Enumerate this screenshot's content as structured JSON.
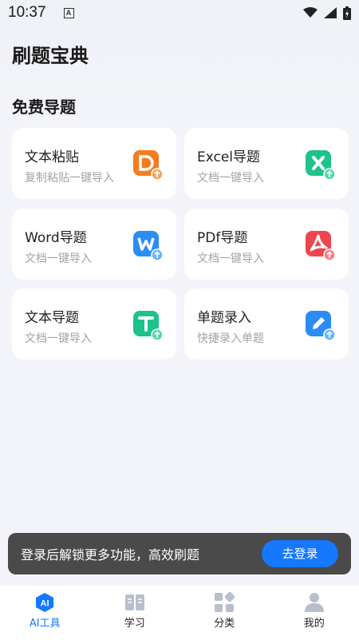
{
  "status_bar": {
    "time": "10:37",
    "notification_glyph": "A"
  },
  "header": {
    "title": "刷题宝典"
  },
  "section": {
    "title": "免费导题"
  },
  "cards": [
    {
      "title": "文本粘贴",
      "subtitle": "复制粘贴一键导入",
      "icon": "paste-doc-icon",
      "color": "#f57c1f"
    },
    {
      "title": "Excel导题",
      "subtitle": "文档一键导入",
      "icon": "excel-icon",
      "color": "#1ec28b"
    },
    {
      "title": "Word导题",
      "subtitle": "文档一键导入",
      "icon": "word-icon",
      "color": "#2b8cf5"
    },
    {
      "title": "PDf导题",
      "subtitle": "文档一键导入",
      "icon": "pdf-icon",
      "color": "#f0444f"
    },
    {
      "title": "文本导题",
      "subtitle": "文档一键导入",
      "icon": "text-doc-icon",
      "color": "#1ec28b"
    },
    {
      "title": "单题录入",
      "subtitle": "快捷录入单题",
      "icon": "pen-edit-icon",
      "color": "#2b8cf5"
    }
  ],
  "toast": {
    "message": "登录后解锁更多功能，高效刷题",
    "button": "去登录"
  },
  "tabbar": {
    "items": [
      {
        "label": "AI工具",
        "icon": "ai-icon",
        "active": true
      },
      {
        "label": "学习",
        "icon": "book-icon",
        "active": false
      },
      {
        "label": "分类",
        "icon": "category-icon",
        "active": false
      },
      {
        "label": "我的",
        "icon": "person-icon",
        "active": false
      }
    ]
  },
  "colors": {
    "accent": "#1677ff",
    "background": "#f3f4f9",
    "toast_bg": "#4a4a4a"
  }
}
